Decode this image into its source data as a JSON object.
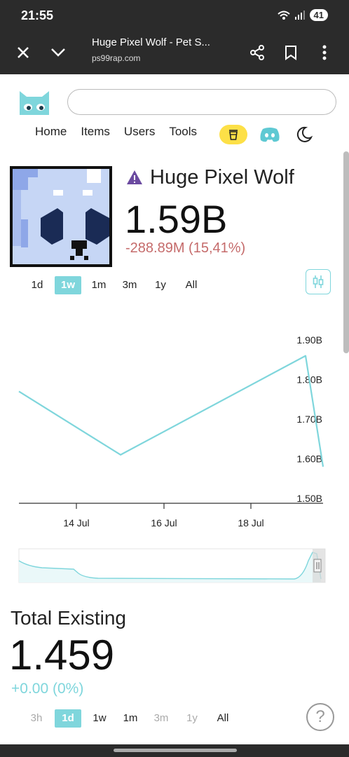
{
  "status": {
    "time": "21:55",
    "battery": "41"
  },
  "browser": {
    "title": "Huge Pixel Wolf - Pet S...",
    "url": "ps99rap.com"
  },
  "nav": {
    "items": [
      "Home",
      "Items",
      "Users",
      "Tools"
    ]
  },
  "pet": {
    "name": "Huge Pixel Wolf",
    "price": "1.59B",
    "change": "-288.89M (15,41%)"
  },
  "ranges_top": {
    "options": [
      "1d",
      "1w",
      "1m",
      "3m",
      "1y",
      "All"
    ],
    "active": "1w"
  },
  "ranges_bottom": {
    "options": [
      "3h",
      "1d",
      "1w",
      "1m",
      "3m",
      "1y",
      "All"
    ],
    "active": "1d"
  },
  "colors": {
    "accent": "#7fd6dc",
    "negative": "#c56b6b",
    "coffee": "#fde047",
    "discord": "#5fc9d3"
  },
  "chart_data": {
    "type": "line",
    "x": [
      "12 Jul",
      "15 Jul",
      "19 Jul",
      "19 Jul 20h"
    ],
    "y": [
      1.77,
      1.61,
      1.86,
      1.58
    ],
    "x_ticks": [
      "14 Jul",
      "16 Jul",
      "18 Jul"
    ],
    "y_ticks": [
      "1.90B",
      "1.80B",
      "1.70B",
      "1.60B",
      "1.50B"
    ],
    "ylim": [
      1.5,
      1.9
    ],
    "legend": "none",
    "grid": false
  },
  "total": {
    "title": "Total Existing",
    "value": "1.459",
    "change": "+0.00 (0%)"
  },
  "help": {
    "label": "?"
  }
}
